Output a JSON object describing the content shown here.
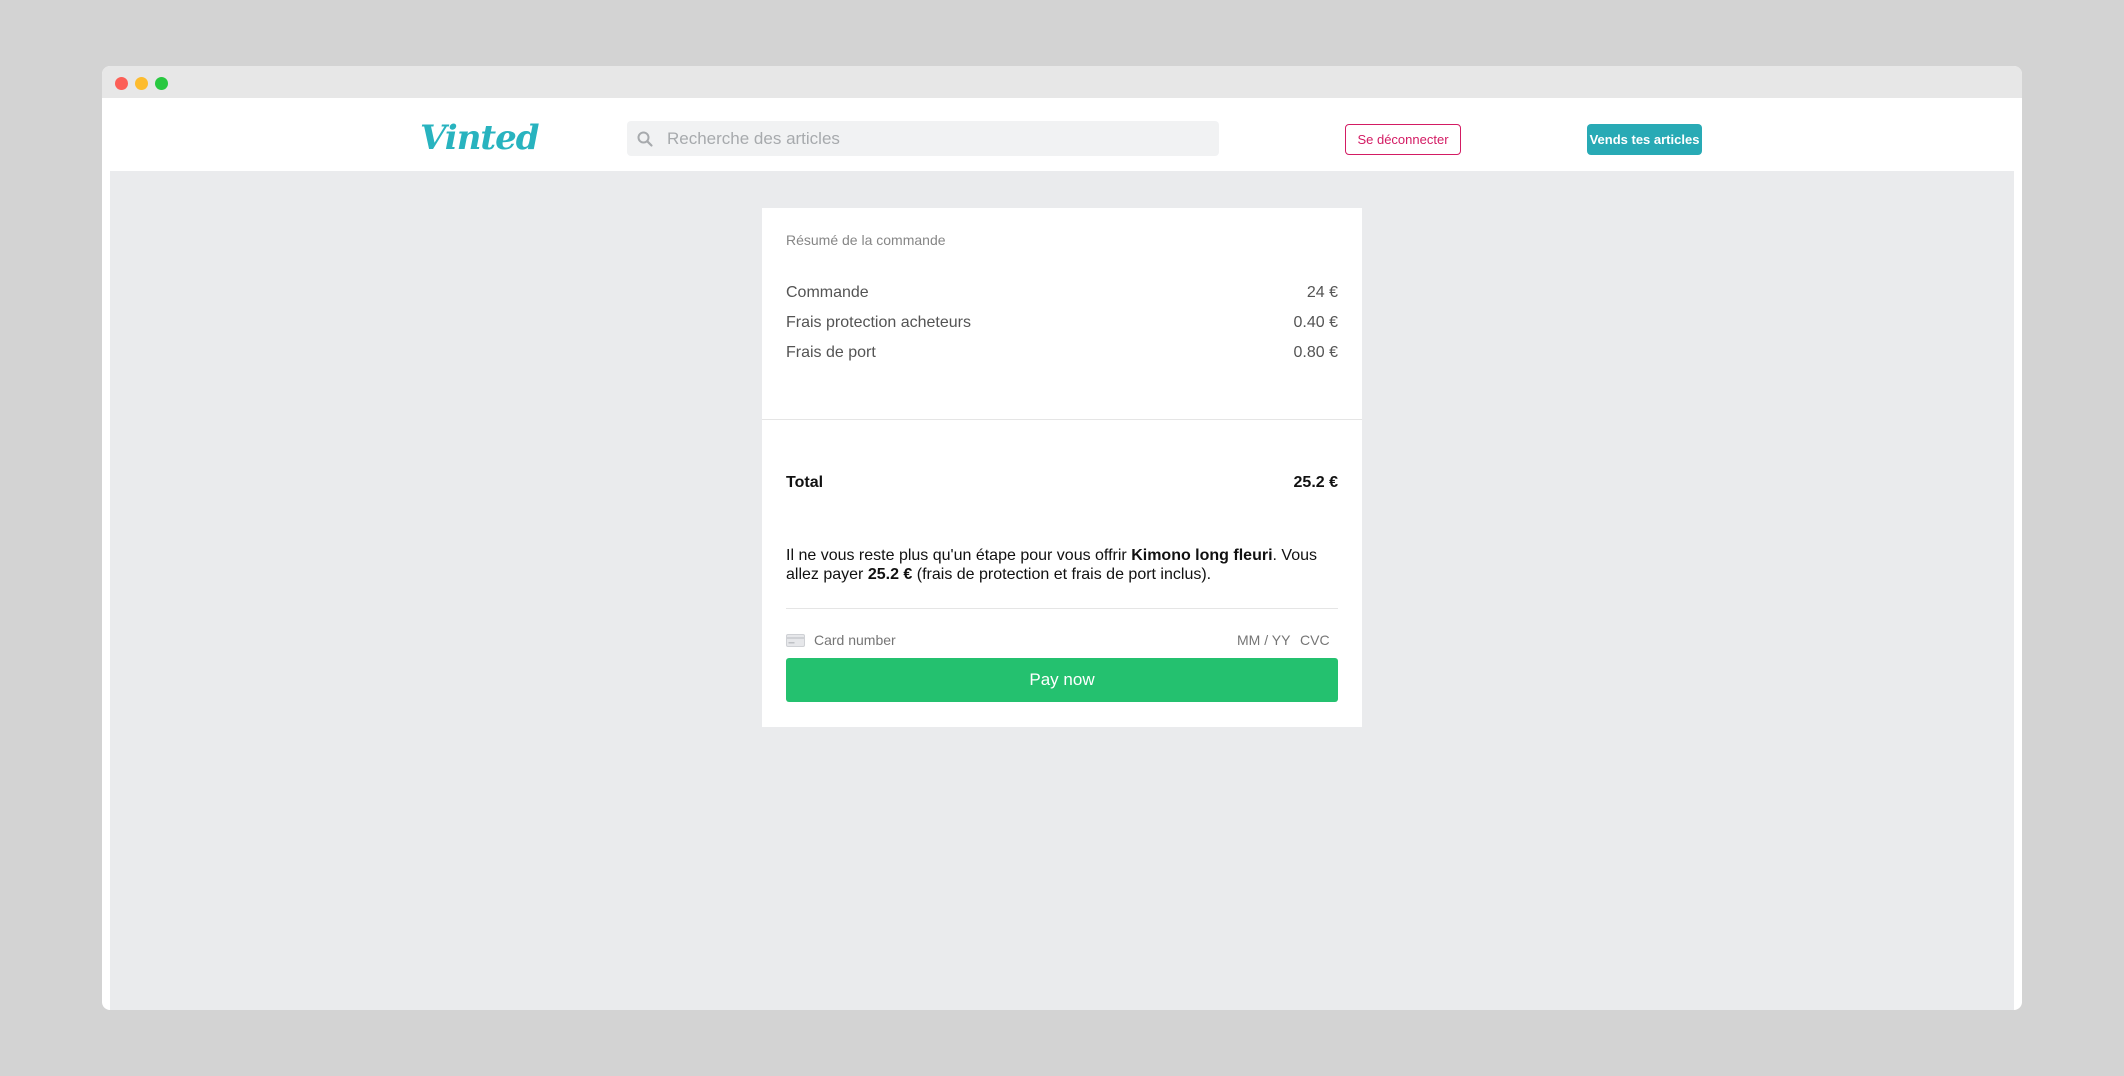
{
  "navbar": {
    "logo_text": "Vinted",
    "search_placeholder": "Recherche des articles",
    "logout_label": "Se déconnecter",
    "sell_label": "Vends tes articles"
  },
  "summary": {
    "title": "Résumé de la commande",
    "lines": [
      {
        "label": "Commande",
        "value": "24 €"
      },
      {
        "label": "Frais protection acheteurs",
        "value": "0.40 €"
      },
      {
        "label": "Frais de port",
        "value": "0.80 €"
      }
    ],
    "total_label": "Total",
    "total_value": "25.2 €"
  },
  "message": {
    "part1": "Il ne vous reste plus qu'un étape pour vous offrir ",
    "item_name": "Kimono long fleuri",
    "part2": ". Vous allez payer ",
    "amount": "25.2 €",
    "part3": " (frais de protection et frais de port inclus)."
  },
  "payment": {
    "card_number_placeholder": "Card number",
    "expiry_placeholder": "MM / YY",
    "cvc_placeholder": "CVC",
    "pay_label": "Pay now"
  },
  "colors": {
    "brand": "#28b3bf",
    "logout": "#d31b63",
    "pay": "#24c16f"
  }
}
